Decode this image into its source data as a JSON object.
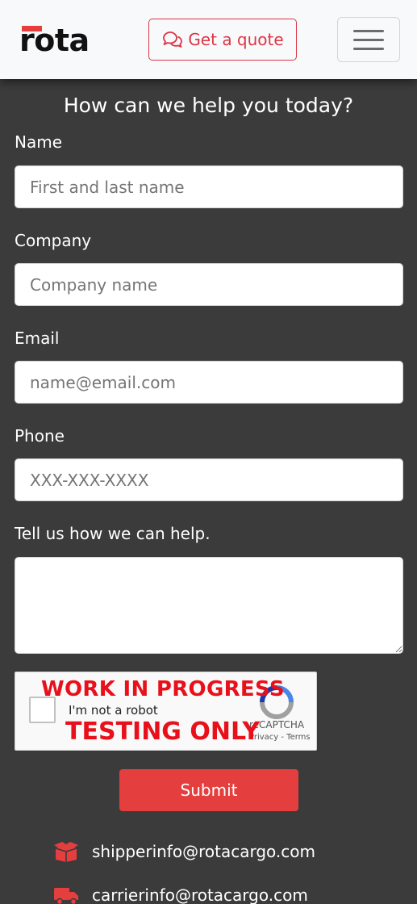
{
  "header": {
    "logo_text": "rota",
    "quote_button_label": "Get a quote",
    "quote_icon": "comments-icon",
    "menu_icon": "hamburger-menu-icon"
  },
  "form": {
    "title": "How can we help you today?",
    "name": {
      "label": "Name",
      "placeholder": "First and last name"
    },
    "company": {
      "label": "Company",
      "placeholder": "Company name"
    },
    "email": {
      "label": "Email",
      "placeholder": "name@email.com"
    },
    "phone": {
      "label": "Phone",
      "placeholder": "XXX-XXX-XXXX"
    },
    "message": {
      "label": "Tell us how we can help.",
      "placeholder": ""
    },
    "submit_label": "Submit"
  },
  "captcha": {
    "checkbox_label": "I'm not a robot",
    "brand": "reCAPTCHA",
    "links": "Privacy - Terms",
    "overlay_top": "WORK IN PROGRESS",
    "overlay_bottom": "TESTING ONLY"
  },
  "contacts": [
    {
      "icon": "box-icon",
      "email": "shipperinfo@rotacargo.com"
    },
    {
      "icon": "truck-icon",
      "email": "carrierinfo@rotacargo.com"
    }
  ],
  "colors": {
    "brand_red": "#e53e3e",
    "background": "#3b3b3b",
    "navbar": "#f8f9fa"
  }
}
